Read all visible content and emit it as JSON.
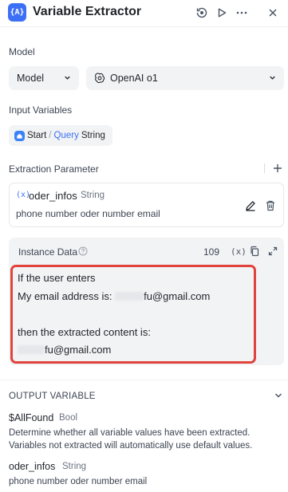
{
  "header": {
    "icon_text": "{A}",
    "title": "Variable Extractor"
  },
  "model": {
    "label": "Model",
    "selector_value": "Model",
    "provider_value": "OpenAI o1"
  },
  "input_variables": {
    "label": "Input Variables",
    "chip": {
      "node": "Start",
      "separator": "/",
      "var": "Query",
      "type": "String"
    }
  },
  "extraction": {
    "label": "Extraction Parameter",
    "param": {
      "icon_text": "(x)",
      "name": "oder_infos",
      "type": "String",
      "description": "phone number oder number email"
    }
  },
  "instance": {
    "label": "Instance Data",
    "count": "109",
    "var_icon_text": "(x)",
    "line1": "If the user enters",
    "line2_prefix": "My email address is: ",
    "line2_suffix": "fu@gmail.com",
    "line4": "then the extracted content is:",
    "line5_suffix": "fu@gmail.com"
  },
  "output": {
    "title": "OUTPUT VARIABLE",
    "vars": [
      {
        "name": "$AllFound",
        "type": "Bool",
        "description": "Determine whether all variable values have been extracted. Variables not extracted will automatically use default values."
      },
      {
        "name": "oder_infos",
        "type": "String",
        "description": "phone number oder number email"
      }
    ]
  },
  "colors": {
    "accent": "#3b6ff5",
    "highlight_border": "#e0443c",
    "panel_bg": "#f2f3f5"
  }
}
